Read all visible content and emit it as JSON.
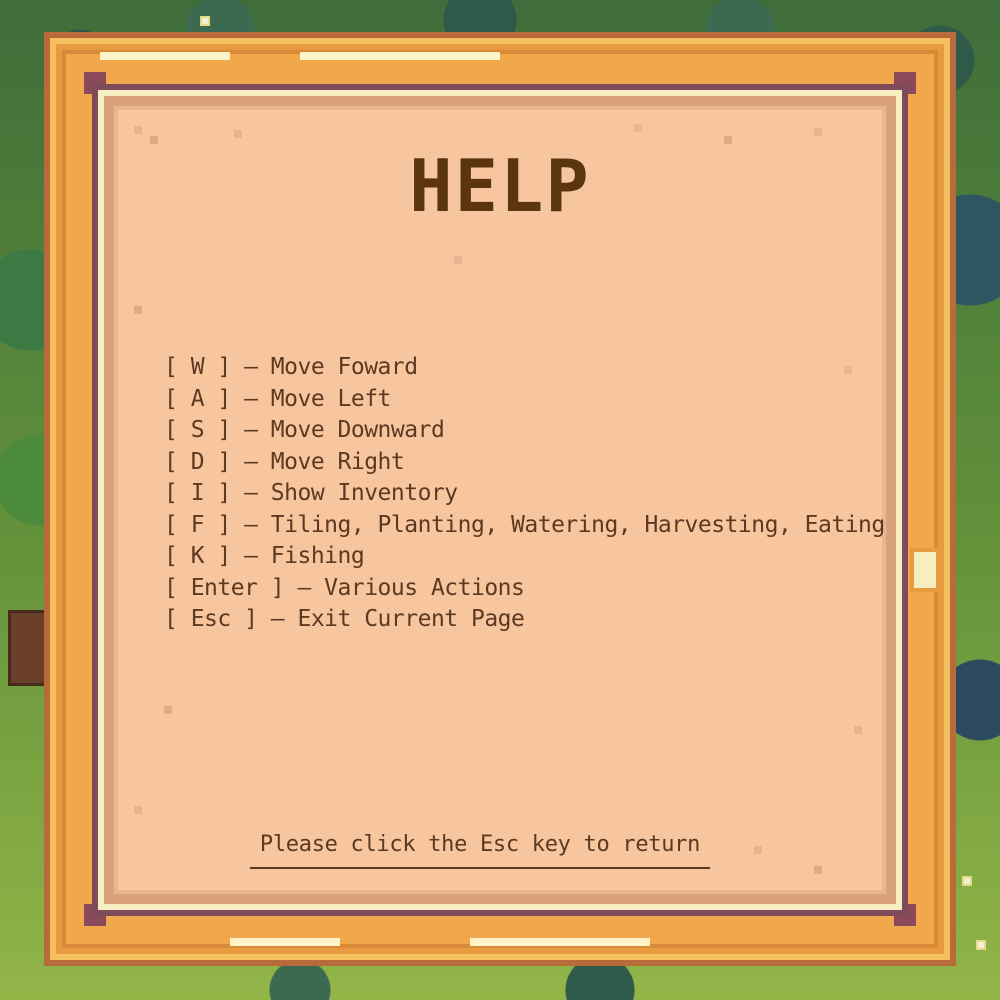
{
  "help_screen": {
    "title": "HELP",
    "controls": [
      "[ W ] – Move Foward",
      "[ A ] – Move Left",
      "[ S ] – Move Downward",
      "[ D ] – Move Right",
      "[ I ] – Show Inventory",
      "[ F ] – Tiling, Planting, Watering, Harvesting, Eating",
      "[ K ] – Fishing",
      "[ Enter ] – Various Actions",
      "[ Esc ] – Exit Current Page"
    ],
    "return_hint": "Please click the Esc key to return"
  },
  "colors": {
    "frame_orange": "#f0a84a",
    "frame_plum": "#7d4b5a",
    "parchment": "#f7c59e",
    "title_brown": "#5a3510",
    "text_brown": "#5c3a22"
  },
  "icons": {
    "background": "forest-grass-background"
  }
}
